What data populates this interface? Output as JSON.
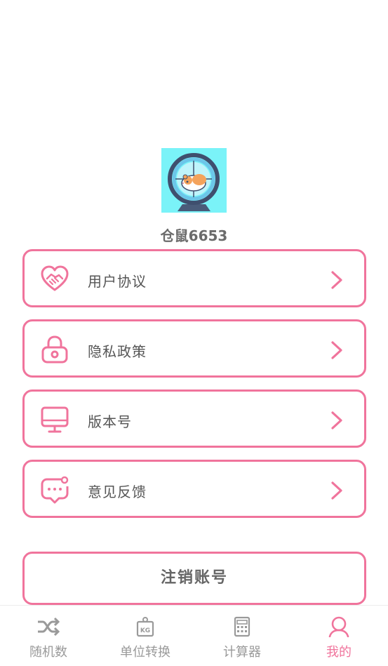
{
  "profile": {
    "username": "仓鼠6653",
    "avatar_icon": "hamster-wheel-icon"
  },
  "menu": [
    {
      "label": "用户协议",
      "icon": "handshake-heart-icon"
    },
    {
      "label": "隐私政策",
      "icon": "lock-icon"
    },
    {
      "label": "版本号",
      "icon": "monitor-icon"
    },
    {
      "label": "意见反馈",
      "icon": "chat-bubble-icon"
    }
  ],
  "logout_label": "注销账号",
  "tabs": [
    {
      "label": "随机数",
      "icon": "shuffle-icon",
      "active": false
    },
    {
      "label": "单位转换",
      "icon": "weight-kg-icon",
      "active": false
    },
    {
      "label": "计算器",
      "icon": "calculator-icon",
      "active": false
    },
    {
      "label": "我的",
      "icon": "user-icon",
      "active": true
    }
  ],
  "colors": {
    "accent": "#f0749c",
    "avatar_bg": "#7af3f8",
    "inactive": "#9a9a9a"
  }
}
